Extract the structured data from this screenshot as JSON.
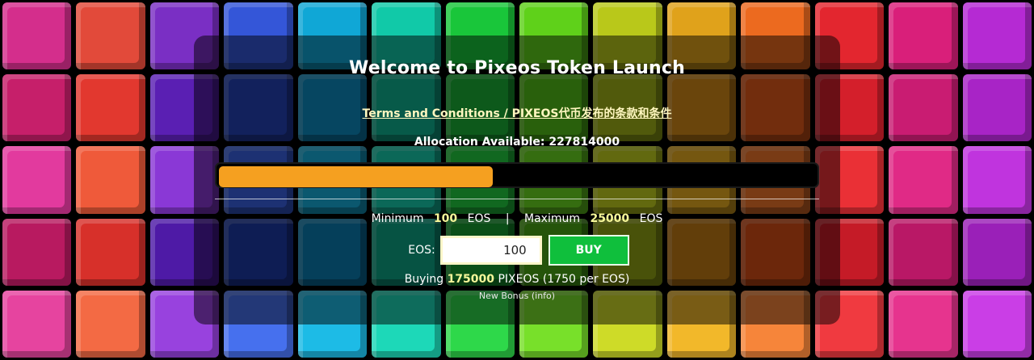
{
  "header": {
    "title": "Welcome to Pixeos Token Launch",
    "terms_link": "Terms and Conditions / PIXEOS代币发布的条款和条件",
    "allocation_label": "Allocation Available:",
    "allocation_value": "227814000"
  },
  "progress": {
    "fraction": 0.46,
    "fill_color": "#f5a020"
  },
  "limits": {
    "minimum_label": "Minimum",
    "minimum_value": "100",
    "minimum_unit": "EOS",
    "separator": "|",
    "maximum_label": "Maximum",
    "maximum_value": "25000",
    "maximum_unit": "EOS"
  },
  "purchase": {
    "input_label": "EOS:",
    "input_value": "100",
    "buy_label": "BUY",
    "buying_prefix": "Buying",
    "buying_amount": "175000",
    "buying_suffix": "PIXEOS (1750 per EOS)",
    "bonus_text": "New Bonus",
    "bonus_info": "(info)"
  },
  "colors": {
    "accent": "#f5a020",
    "highlight": "#f7f79a",
    "buy_button": "#0fbf3c"
  },
  "background_palette": [
    "#d42e8c",
    "#e24a3a",
    "#7a2fc4",
    "#3456d8",
    "#10a7d6",
    "#11c9a8",
    "#19c63a",
    "#5fd11a",
    "#b9c81a",
    "#e0a21b",
    "#ec6a1f",
    "#e3262f",
    "#d91f7a",
    "#b52ad3",
    "#c61f6a",
    "#e2382f",
    "#5a1fb3",
    "#2442b8",
    "#0d8dc2",
    "#0fb593",
    "#1bb237",
    "#53c018",
    "#a3b518",
    "#d48a18",
    "#e55a1a",
    "#d41f2b",
    "#c91c72",
    "#a824c6",
    "#e23a9e",
    "#ef5a3a",
    "#8a38d6",
    "#3a62e6",
    "#16b0df",
    "#16d0b0",
    "#23d140",
    "#6bda20",
    "#c4d21e",
    "#ebae20",
    "#f2772a",
    "#ea3036",
    "#e02a86",
    "#c034de",
    "#b81a60",
    "#d7302a",
    "#4e1aa6",
    "#1d3aa8",
    "#0b7fb5",
    "#0ca687",
    "#179f31",
    "#4aa915",
    "#93a515",
    "#c47c15",
    "#d84f16",
    "#c51b27",
    "#b91866",
    "#9a20b8",
    "#e6449f",
    "#f36a44",
    "#9842de",
    "#4670ee",
    "#1dbbe6",
    "#1dd8b8",
    "#2ed84a",
    "#78e02a",
    "#cedb28",
    "#f2b82a",
    "#f6853a",
    "#f03a40",
    "#e6348e",
    "#ca3ee6"
  ]
}
